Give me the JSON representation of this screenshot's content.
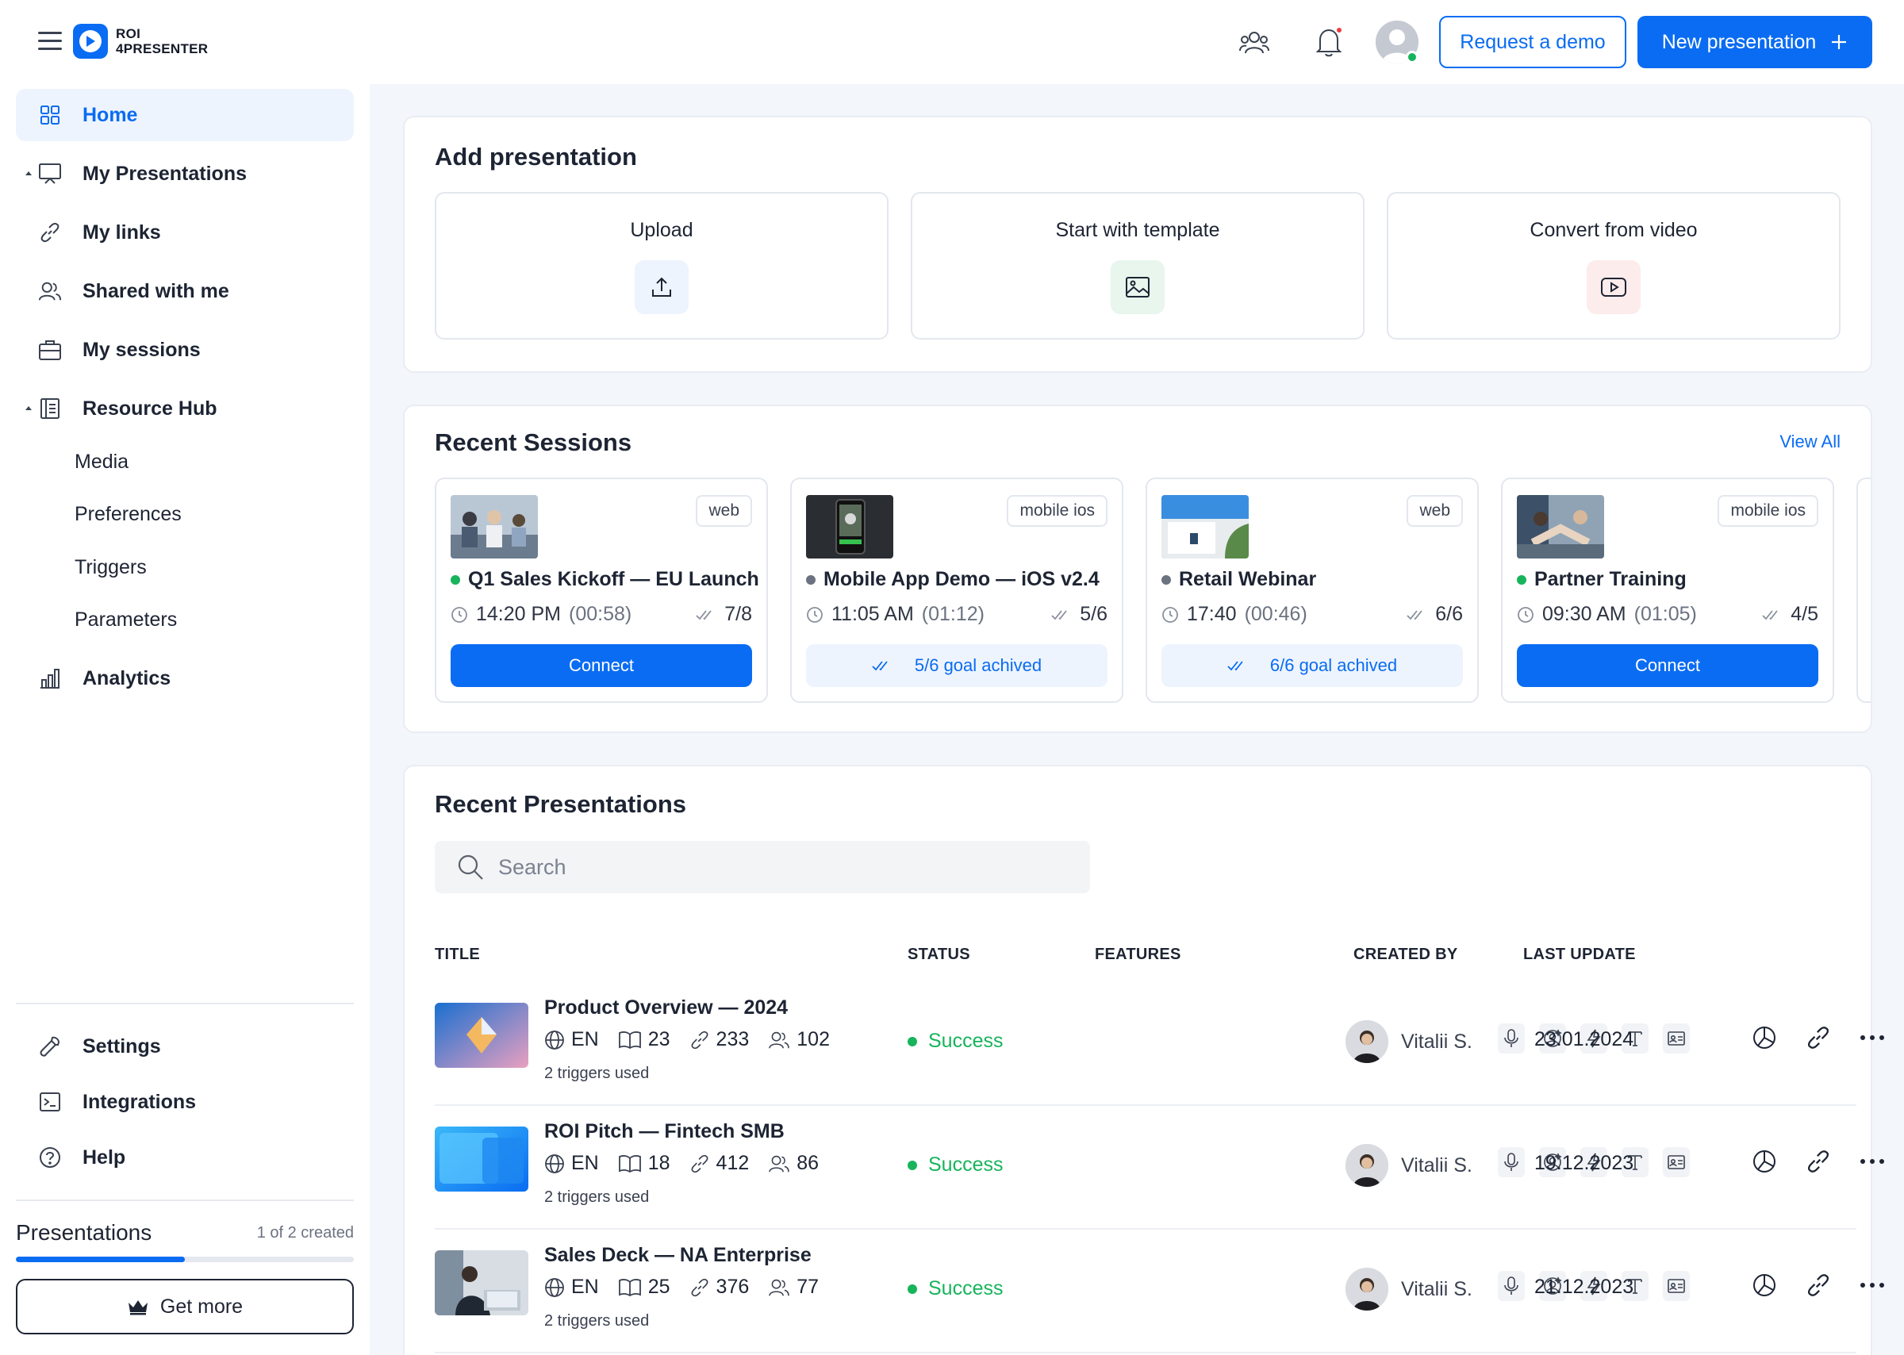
{
  "app": {
    "logo_line1": "ROI",
    "logo_line2": "4PRESENTER"
  },
  "header": {
    "request_demo_label": "Request a demo",
    "new_presentation_label": "New presentation",
    "icons": [
      "team-icon",
      "bell-icon",
      "user-avatar"
    ]
  },
  "sidebar": {
    "items": [
      {
        "label": "Home",
        "icon": "grid-icon",
        "active": true
      },
      {
        "label": "My Presentations",
        "icon": "presentation-icon"
      },
      {
        "label": "My links",
        "icon": "link-icon"
      },
      {
        "label": "Shared with me",
        "icon": "users-icon"
      },
      {
        "label": "My sessions",
        "icon": "briefcase-icon"
      },
      {
        "label": "Resource Hub",
        "icon": "document-icon"
      }
    ],
    "sub_items": [
      "Media",
      "Preferences",
      "Triggers",
      "Parameters"
    ],
    "analytics_label": "Analytics",
    "bottom_items": [
      {
        "label": "Settings",
        "icon": "wrench-icon"
      },
      {
        "label": "Integrations",
        "icon": "terminal-icon"
      },
      {
        "label": "Help",
        "icon": "help-icon"
      }
    ],
    "presentations_label": "Presentations",
    "presentations_count": "1 of 2 created",
    "presentations_progress": 0.5,
    "get_more_label": "Get more"
  },
  "add_presentation": {
    "title": "Add presentation",
    "tiles": [
      {
        "label": "Upload",
        "icon": "upload-icon"
      },
      {
        "label": "Start with template",
        "icon": "image-icon"
      },
      {
        "label": "Convert from video",
        "icon": "video-icon"
      }
    ]
  },
  "recent_sessions": {
    "title": "Recent Sessions",
    "view_all": "View All",
    "sessions": [
      {
        "tag": "web",
        "title": "Q1 Sales Kickoff — EU Launch",
        "status_color": "#17b45c",
        "time": "14:20 PM",
        "duration": "(00:58)",
        "goal": "7/8",
        "action": "Connect"
      },
      {
        "tag": "mobile ios",
        "title": "Mobile App Demo — iOS v2.4",
        "status_color": "#6b7280",
        "time": "11:05 AM",
        "duration": "(01:12)",
        "goal": "5/6",
        "action": "5/6 goal achived"
      },
      {
        "tag": "web",
        "title": "Retail Webinar",
        "status_color": "#6b7280",
        "time": "17:40",
        "duration": "(00:46)",
        "goal": "6/6",
        "action": "6/6 goal achived"
      },
      {
        "tag": "mobile ios",
        "title": "Partner Training",
        "status_color": "#17b45c",
        "time": "09:30 AM",
        "duration": "(01:05)",
        "goal": "4/5",
        "action": "Connect"
      }
    ]
  },
  "recent_presentations": {
    "title": "Recent Presentations",
    "search_placeholder": "Search",
    "columns": [
      "TITLE",
      "STATUS",
      "FEATURES",
      "CREATED BY",
      "LAST UPDATE"
    ],
    "rows": [
      {
        "title": "Product Overview — 2024",
        "lang": "EN",
        "slides": "23",
        "links": "233",
        "viewers": "102",
        "triggers": "2 triggers used",
        "status": "Success",
        "creator": "Vitalii S.",
        "updated": "23.01.2024"
      },
      {
        "title": "ROI Pitch — Fintech SMB",
        "lang": "EN",
        "slides": "18",
        "links": "412",
        "viewers": "86",
        "triggers": "2 triggers used",
        "status": "Success",
        "creator": "Vitalii S.",
        "updated": "19.12.2023"
      },
      {
        "title": "Sales Deck — NA Enterprise",
        "lang": "EN",
        "slides": "25",
        "links": "376",
        "viewers": "77",
        "triggers": "2 triggers used",
        "status": "Success",
        "creator": "Vitalii S.",
        "updated": "21.12.2023"
      }
    ]
  },
  "colors": {
    "accent": "#0a6cf2",
    "success": "#17b45c",
    "notification": "#f03b3b"
  }
}
